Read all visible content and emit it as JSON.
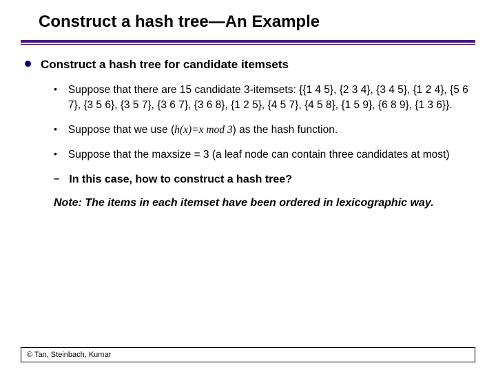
{
  "title": "Construct a hash tree—An Example",
  "heading": "Construct a hash tree for candidate itemsets",
  "bullets": {
    "b1": "Suppose that there are 15 candidate 3-itemsets: {{1 4 5}, {2 3 4}, {3 4 5}, {1 2 4}, {5 6 7}, {3 5 6}, {3 5 7}, {3 6 7}, {3 6 8}, {1 2 5}, {4 5 7}, {4 5 8}, {1 5 9}, {6 8 9}, {1 3 6}}.",
    "b2_pre": "Suppose that we use (",
    "b2_hash": "h(x)=x mod 3",
    "b2_post": ") as the hash function.",
    "b3": "Suppose that the maxsize = 3 (a leaf node can contain three candidates at most)"
  },
  "question": "In this case, how to construct a hash tree?",
  "note": "Note: The items in each itemset have been ordered in lexicographic way.",
  "footer": "© Tan, Steinbach, Kumar"
}
